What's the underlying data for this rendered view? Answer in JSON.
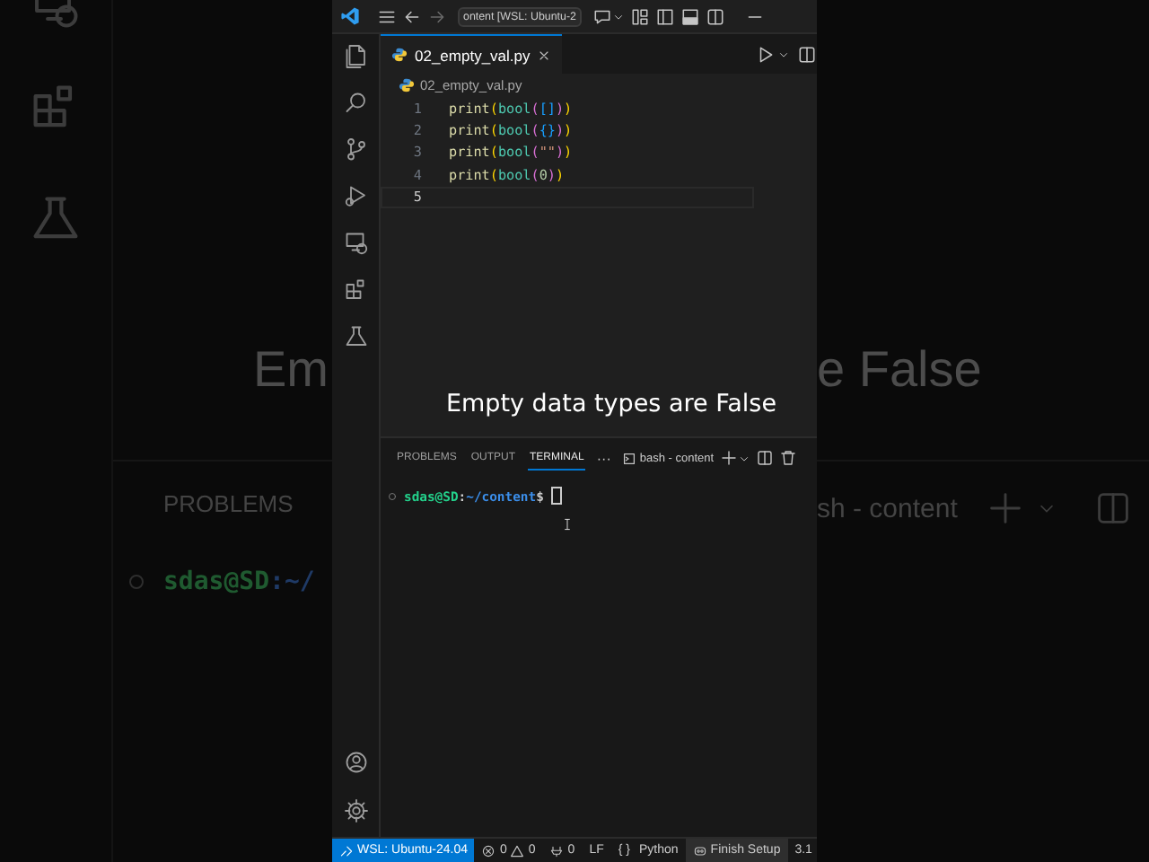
{
  "backdrop": {
    "left": {
      "heading": "Em",
      "panel_tab": "PROBLEMS",
      "prompt": {
        "user": "sdas@SD",
        "path": ":~/"
      }
    },
    "right": {
      "heading": "e False",
      "terminal_name": "sh - content"
    }
  },
  "title_bar": {
    "command_center": "ontent [WSL: Ubuntu-2"
  },
  "editor": {
    "tabs": [
      {
        "label": "02_empty_val.py",
        "selected": true
      }
    ],
    "breadcrumb": "02_empty_val.py",
    "lines": [
      {
        "number": "1",
        "current": false,
        "tokens": [
          {
            "text": "print",
            "kind": "function"
          },
          {
            "text": "(",
            "kind": "bracket1"
          },
          {
            "text": "bool",
            "kind": "builtin"
          },
          {
            "text": "(",
            "kind": "bracket2"
          },
          {
            "text": "[]",
            "kind": "bracket3"
          },
          {
            "text": ")",
            "kind": "bracket2"
          },
          {
            "text": ")",
            "kind": "bracket1"
          }
        ]
      },
      {
        "number": "2",
        "current": false,
        "tokens": [
          {
            "text": "print",
            "kind": "function"
          },
          {
            "text": "(",
            "kind": "bracket1"
          },
          {
            "text": "bool",
            "kind": "builtin"
          },
          {
            "text": "(",
            "kind": "bracket2"
          },
          {
            "text": "{}",
            "kind": "bracket3"
          },
          {
            "text": ")",
            "kind": "bracket2"
          },
          {
            "text": ")",
            "kind": "bracket1"
          }
        ]
      },
      {
        "number": "3",
        "current": false,
        "tokens": [
          {
            "text": "print",
            "kind": "function"
          },
          {
            "text": "(",
            "kind": "bracket1"
          },
          {
            "text": "bool",
            "kind": "builtin"
          },
          {
            "text": "(",
            "kind": "bracket2"
          },
          {
            "text": "\"\"",
            "kind": "string"
          },
          {
            "text": ")",
            "kind": "bracket2"
          },
          {
            "text": ")",
            "kind": "bracket1"
          }
        ]
      },
      {
        "number": "4",
        "current": false,
        "tokens": [
          {
            "text": "print",
            "kind": "function"
          },
          {
            "text": "(",
            "kind": "bracket1"
          },
          {
            "text": "bool",
            "kind": "builtin"
          },
          {
            "text": "(",
            "kind": "bracket2"
          },
          {
            "text": "0",
            "kind": "number"
          },
          {
            "text": ")",
            "kind": "bracket2"
          },
          {
            "text": ")",
            "kind": "bracket1"
          }
        ]
      },
      {
        "number": "5",
        "current": true
      }
    ]
  },
  "caption": "Empty data types are False",
  "panel": {
    "tabs": [
      {
        "label": "PROBLEMS",
        "selected": false
      },
      {
        "label": "OUTPUT",
        "selected": false
      },
      {
        "label": "TERMINAL",
        "selected": true
      }
    ],
    "more": "···",
    "terminal_name": "bash - content",
    "prompt": {
      "user": "sdas@SD",
      "separator": ":",
      "path": "~/content",
      "symbol": "$"
    }
  },
  "status_bar": {
    "remote": "WSL: Ubuntu-24.04",
    "errors": "0",
    "warnings": "0",
    "ports": "0",
    "eol": "LF",
    "language_icon": "{ }",
    "language": "Python",
    "setup": "Finish Setup",
    "version": "3.1"
  }
}
